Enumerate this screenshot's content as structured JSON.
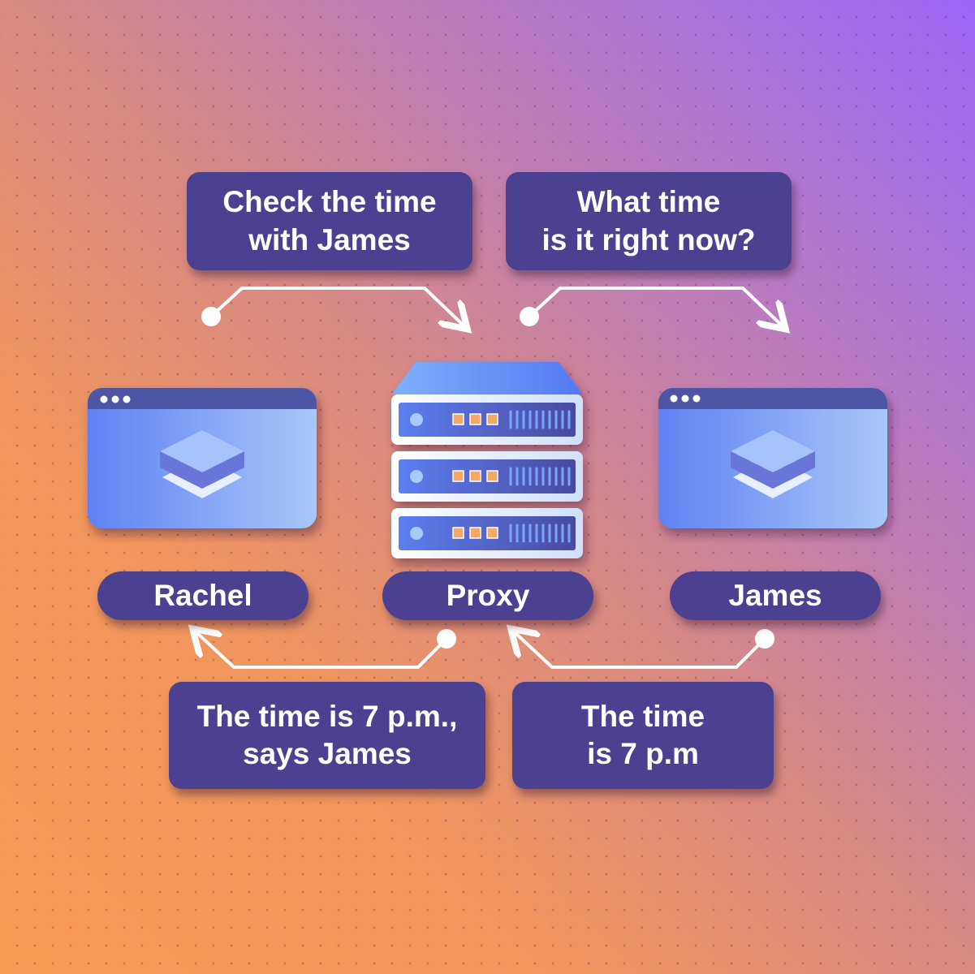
{
  "messages": {
    "request_to_proxy": "Check the time\nwith James",
    "request_to_james": "What time\nis it right now?",
    "response_to_rachel": "The time is 7 p.m.,\nsays James",
    "response_from_james": "The time\nis 7 p.m"
  },
  "nodes": {
    "client": "Rachel",
    "proxy": "Proxy",
    "server": "James"
  },
  "colors": {
    "box": "#4b4190",
    "arrow": "#ffffff",
    "window_bar": "#4e54a4",
    "server_blue": "#5b7cf0"
  }
}
